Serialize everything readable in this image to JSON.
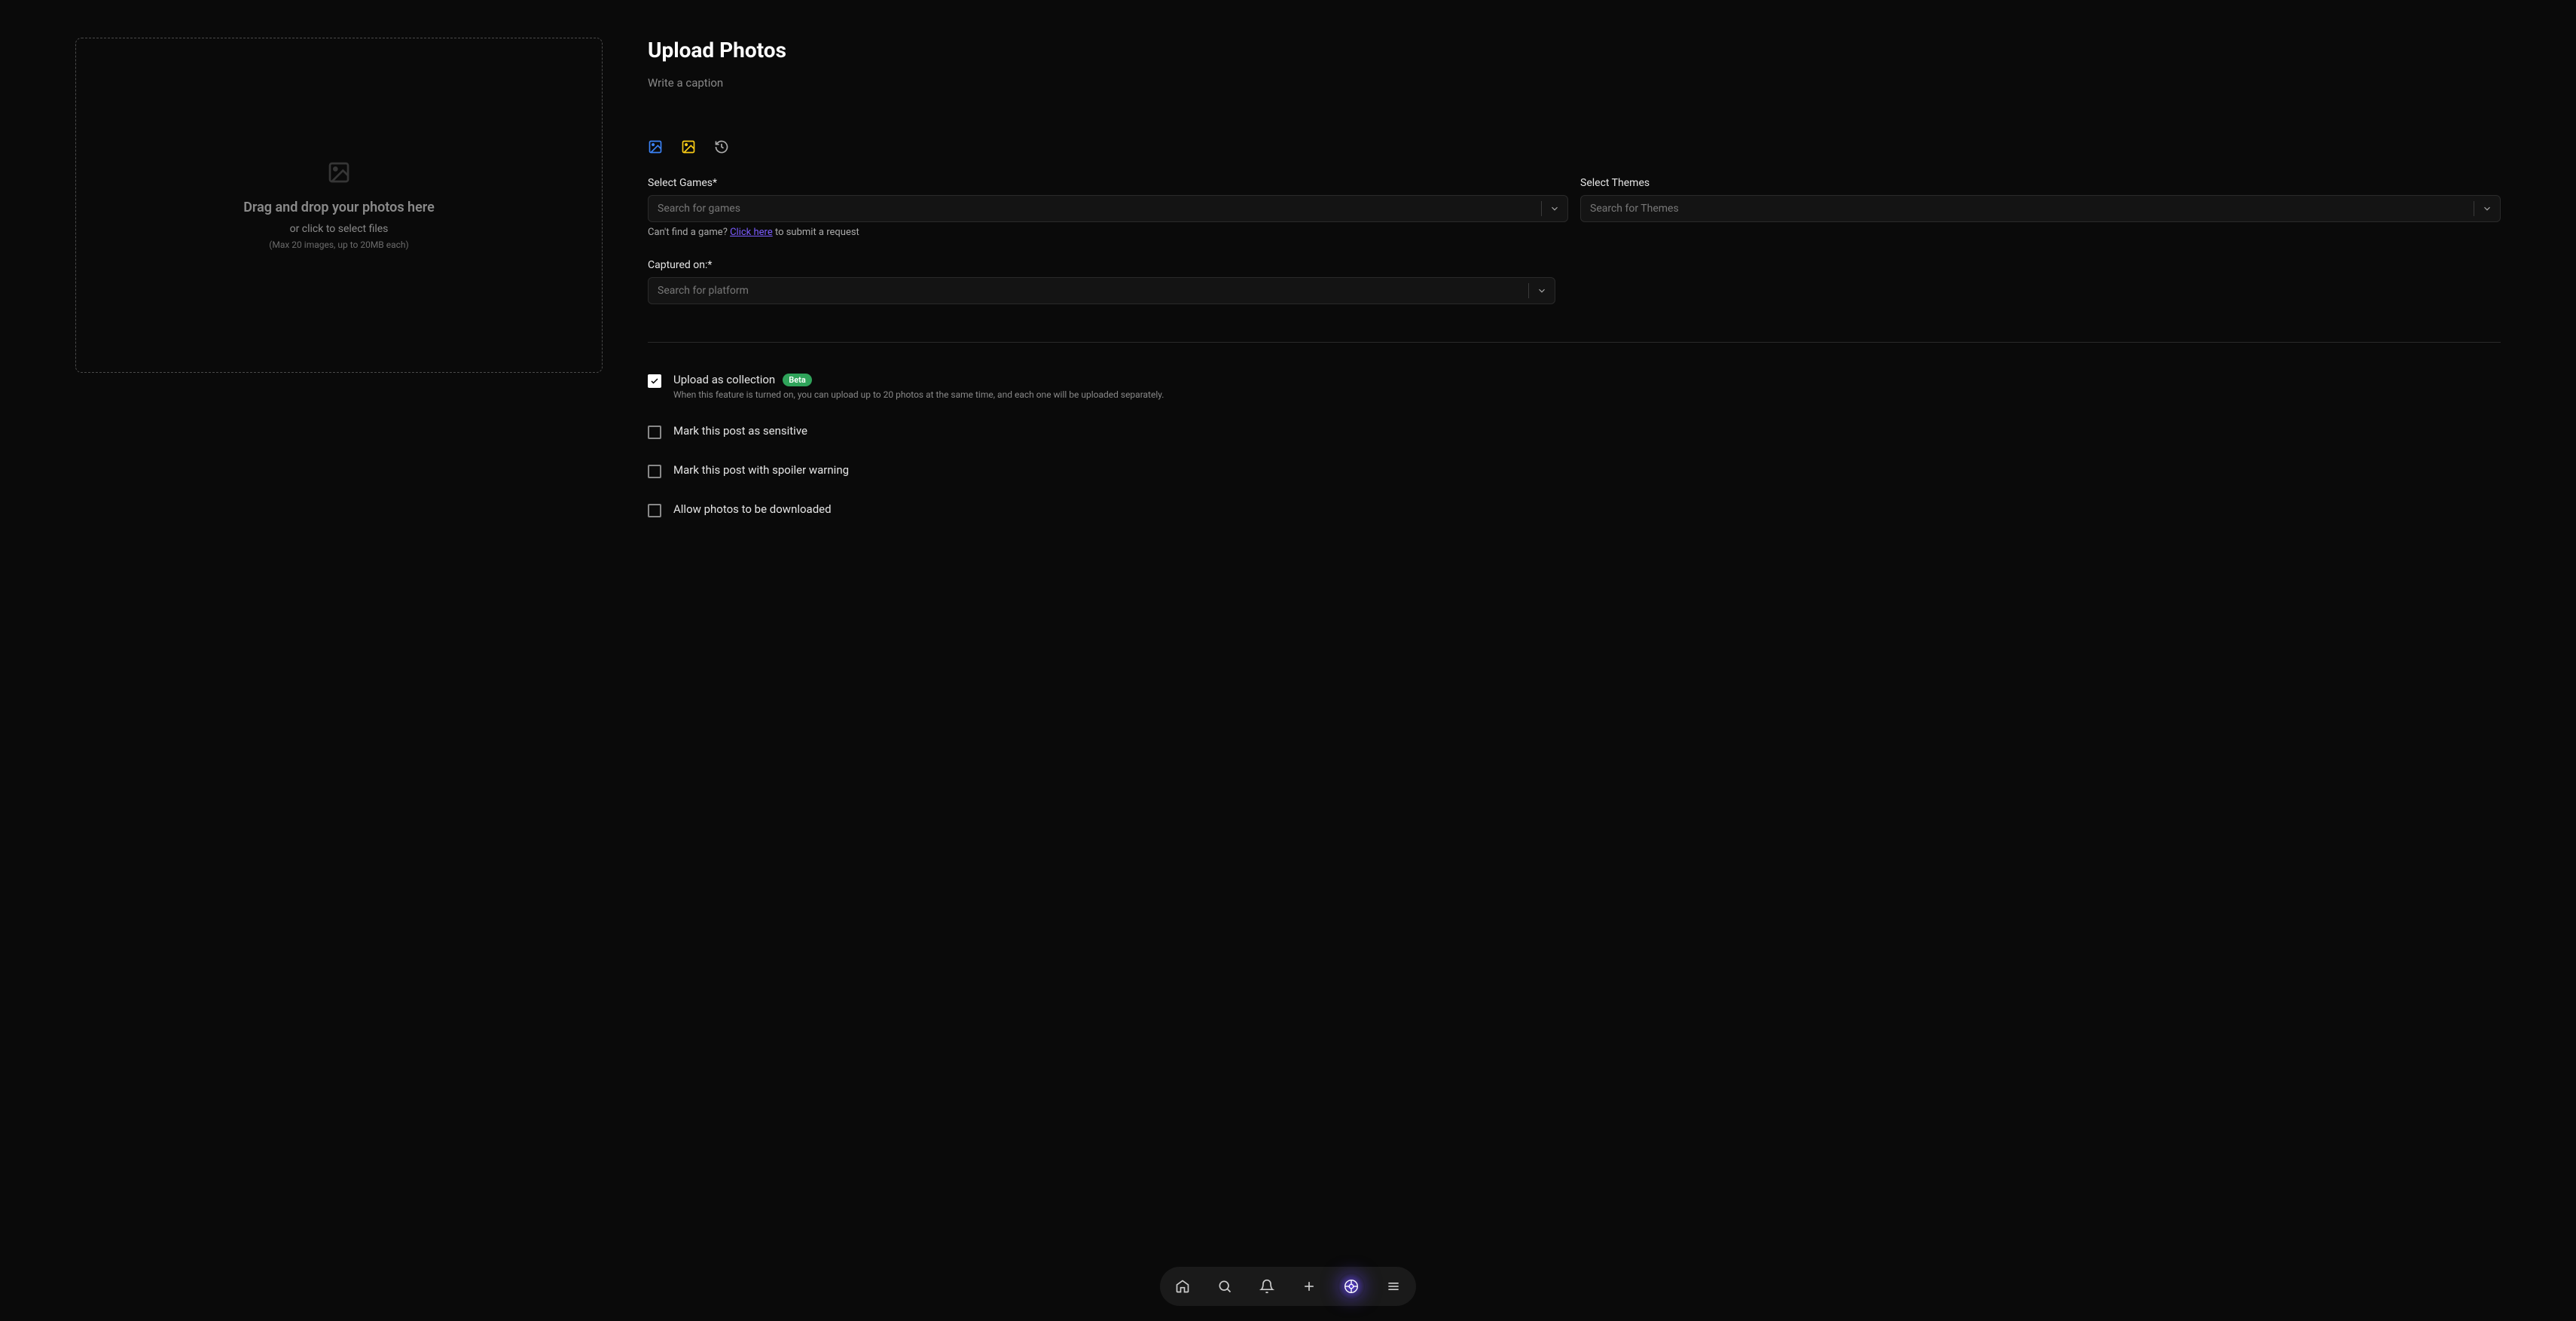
{
  "page": {
    "title": "Upload Photos"
  },
  "dropzone": {
    "title": "Drag and drop your photos here",
    "subtitle": "or click to select files",
    "hint": "(Max 20 images, up to 20MB each)"
  },
  "caption": {
    "placeholder": "Write a caption"
  },
  "fields": {
    "games": {
      "label": "Select Games*",
      "placeholder": "Search for games",
      "helper_prefix": "Can't find a game? ",
      "helper_link": "Click here",
      "helper_suffix": " to submit a request"
    },
    "themes": {
      "label": "Select Themes",
      "placeholder": "Search for Themes"
    },
    "platform": {
      "label": "Captured on:*",
      "placeholder": "Search for platform"
    }
  },
  "options": {
    "collection": {
      "label": "Upload as collection",
      "badge": "Beta",
      "description": "When this feature is turned on, you can upload up to 20 photos at the same time, and each one will be uploaded separately.",
      "checked": true
    },
    "sensitive": {
      "label": "Mark this post as sensitive",
      "checked": false
    },
    "spoiler": {
      "label": "Mark this post with spoiler warning",
      "checked": false
    },
    "download": {
      "label": "Allow photos to be downloaded",
      "checked": false
    }
  }
}
